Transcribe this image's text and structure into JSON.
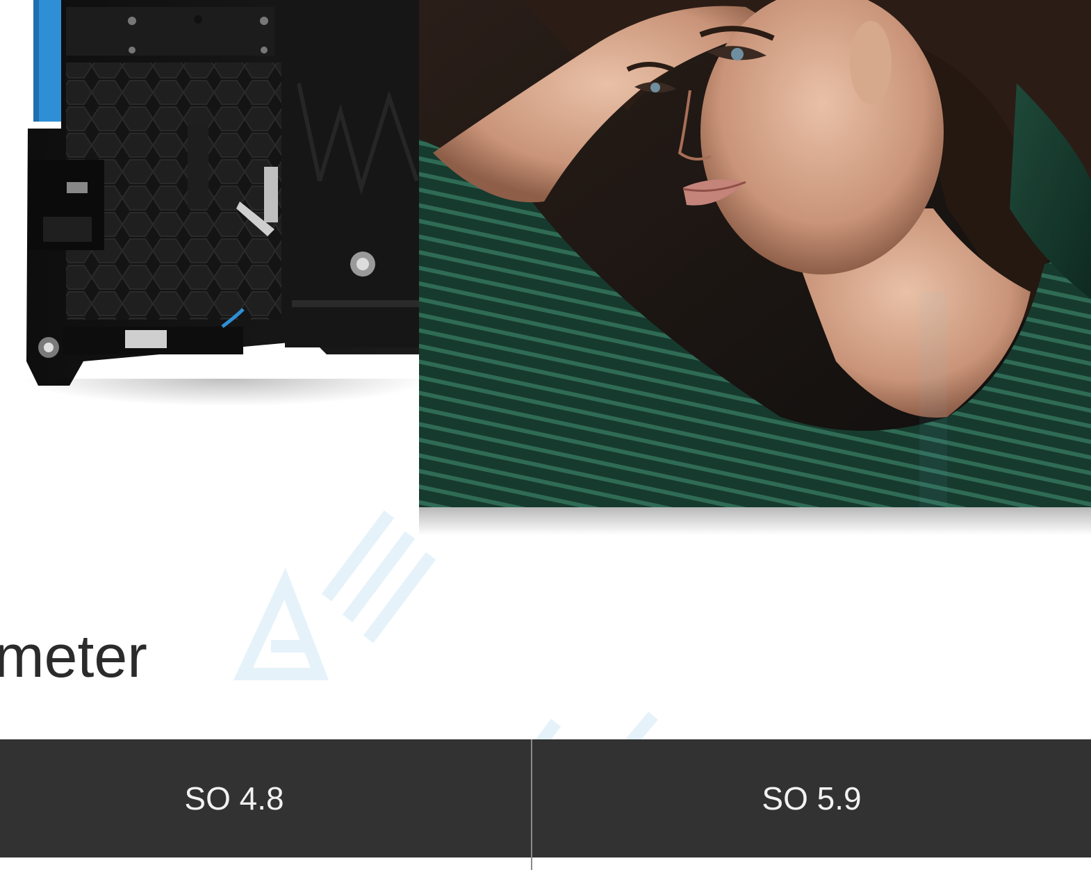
{
  "section": {
    "heading": "meter"
  },
  "table": {
    "columns": [
      "SO 4.8",
      "SO 5.9"
    ]
  },
  "images": {
    "cabinet": "led-cabinet-back-photo",
    "display": "woman-portrait-on-led-screen"
  },
  "colors": {
    "table_header_bg": "#323232",
    "table_header_text": "#f2f2f2",
    "heading_text": "#2b2b2b",
    "cabinet_accent": "#2f8fd6",
    "watermark": "#d9ecf7"
  }
}
